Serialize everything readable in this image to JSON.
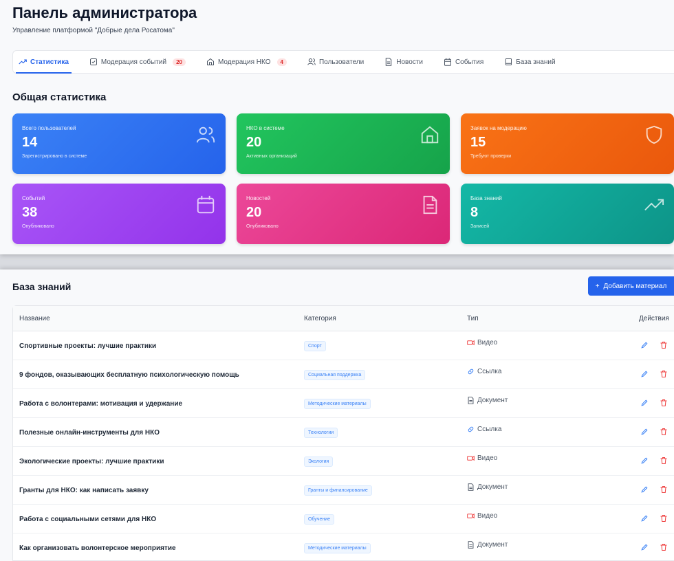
{
  "header": {
    "title": "Панель администратора",
    "subtitle": "Управление платформой \"Добрые дела Росатома\""
  },
  "tabs": [
    {
      "label": "Статистика",
      "icon": "trend-icon",
      "active": true
    },
    {
      "label": "Модерация событий",
      "icon": "check-square-icon",
      "badge": "20"
    },
    {
      "label": "Модерация НКО",
      "icon": "home-icon",
      "badge": "4"
    },
    {
      "label": "Пользователи",
      "icon": "users-icon"
    },
    {
      "label": "Новости",
      "icon": "document-icon"
    },
    {
      "label": "События",
      "icon": "calendar-icon"
    },
    {
      "label": "База знаний",
      "icon": "book-icon"
    }
  ],
  "stats": {
    "title": "Общая статистика",
    "cards": [
      {
        "label": "Всего пользователей",
        "value": "14",
        "sub": "Зарегистрировано в системе",
        "icon": "users-icon",
        "color": "#3b82f6"
      },
      {
        "label": "НКО в системе",
        "value": "20",
        "sub": "Активных организаций",
        "icon": "home-icon",
        "color": "#22c55e"
      },
      {
        "label": "Заявок на модерацию",
        "value": "15",
        "sub": "Требуют проверки",
        "icon": "shield-icon",
        "color": "#f97316"
      },
      {
        "label": "Событий",
        "value": "38",
        "sub": "Опубликовано",
        "icon": "calendar-icon",
        "color": "#a855f7"
      },
      {
        "label": "Новостей",
        "value": "20",
        "sub": "Опубликовано",
        "icon": "document-icon",
        "color": "#ec4899"
      },
      {
        "label": "База знаний",
        "value": "8",
        "sub": "Записей",
        "icon": "trend-icon",
        "color": "#14b8a6"
      }
    ]
  },
  "kb": {
    "title": "База знаний",
    "add_button": "Добавить материал",
    "columns": [
      "Название",
      "Категория",
      "Тип",
      "Действия"
    ],
    "rows": [
      {
        "name": "Спортивные проекты: лучшие практики",
        "category": "Спорт",
        "type": "Видео",
        "type_icon": "video-icon"
      },
      {
        "name": "9 фондов, оказывающих бесплатную психологическую помощь",
        "category": "Социальная поддержка",
        "type": "Ссылка",
        "type_icon": "link-icon"
      },
      {
        "name": "Работа с волонтерами: мотивация и удержание",
        "category": "Методические материалы",
        "type": "Документ",
        "type_icon": "file-icon"
      },
      {
        "name": "Полезные онлайн-инструменты для НКО",
        "category": "Технологии",
        "type": "Ссылка",
        "type_icon": "link-icon"
      },
      {
        "name": "Экологические проекты: лучшие практики",
        "category": "Экология",
        "type": "Видео",
        "type_icon": "video-icon"
      },
      {
        "name": "Гранты для НКО: как написать заявку",
        "category": "Гранты и финансирование",
        "type": "Документ",
        "type_icon": "file-icon"
      },
      {
        "name": "Работа с социальными сетями для НКО",
        "category": "Обучение",
        "type": "Видео",
        "type_icon": "video-icon"
      },
      {
        "name": "Как организовать волонтерское мероприятие",
        "category": "Методические материалы",
        "type": "Документ",
        "type_icon": "file-icon"
      }
    ]
  }
}
